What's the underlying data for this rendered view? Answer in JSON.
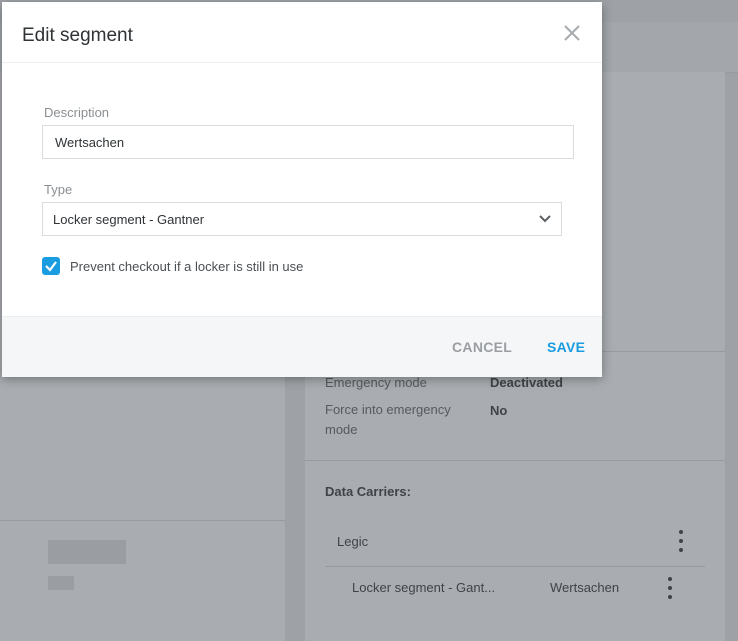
{
  "modal": {
    "title": "Edit segment",
    "description_label": "Description",
    "description_value": "Wertsachen",
    "type_label": "Type",
    "type_value": "Locker segment - Gantner",
    "checkbox_label": "Prevent checkout if a locker is still in use",
    "checkbox_checked": true,
    "cancel_label": "CANCEL",
    "save_label": "SAVE",
    "accent_color": "#1a9ce0"
  },
  "background": {
    "emergency_mode_label": "Emergency mode",
    "emergency_mode_value": "Deactivated",
    "force_emergency_label": "Force into emergency mode",
    "force_emergency_value": "No",
    "data_carriers_label": "Data Carriers:",
    "carrier_name": "Legic",
    "segment_row_name": "Locker segment - Gant...",
    "segment_row_description": "Wertsachen"
  }
}
